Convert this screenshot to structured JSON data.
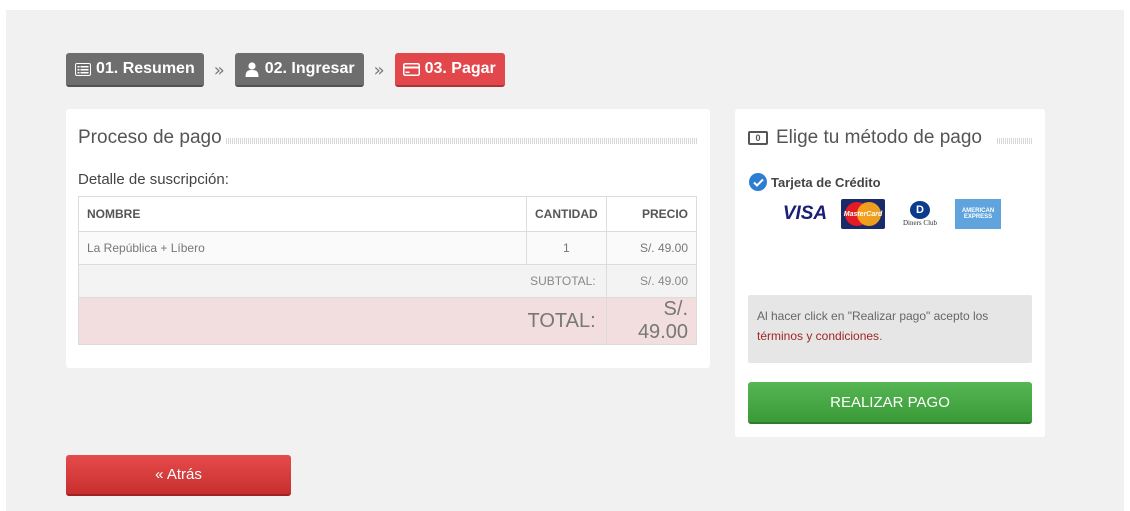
{
  "steps": [
    {
      "label": "01. Resumen",
      "icon": "list-icon",
      "state": "done"
    },
    {
      "label": "02. Ingresar",
      "icon": "user-icon",
      "state": "done"
    },
    {
      "label": "03. Pagar",
      "icon": "credit-card-icon",
      "state": "active"
    }
  ],
  "step_separator": "»",
  "process": {
    "title": "Proceso de pago",
    "subtitle": "Detalle de suscripción:",
    "table": {
      "headers": {
        "name": "NOMBRE",
        "qty": "CANTIDAD",
        "price": "PRECIO"
      },
      "rows": [
        {
          "name": "La República + Líbero",
          "qty": "1",
          "price": "S/. 49.00"
        }
      ],
      "subtotal_label": "SUBTOTAL:",
      "subtotal_value": "S/. 49.00",
      "total_label": "TOTAL:",
      "total_value": "S/. 49.00"
    }
  },
  "payment": {
    "title": "Elige tu método de pago",
    "method_label": "Tarjeta de Crédito",
    "cards": {
      "visa": "VISA",
      "mastercard": "MasterCard",
      "diners_mark": "D",
      "diners": "Diners Club",
      "amex_1": "AMERICAN",
      "amex_2": "EXPRESS"
    },
    "terms_text": "Al hacer click en \"Realizar pago\" acepto los",
    "terms_link": "términos y condiciones",
    "terms_end": ".",
    "pay_button": "REALIZAR PAGO"
  },
  "back_button": "« Atrás",
  "colors": {
    "active_step": "#e2474b",
    "done_step": "#6e6e6e",
    "pay": "#4cae4c",
    "back": "#d9534f",
    "total_row": "#f2dede"
  }
}
